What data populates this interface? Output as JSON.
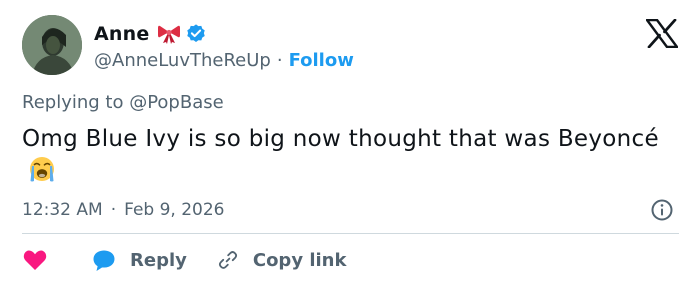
{
  "author": {
    "display_name": "Anne",
    "handle": "@AnneLuvTheReUp",
    "follow_label": "Follow",
    "separator": "·"
  },
  "reply_context": {
    "text": "Replying to @PopBase"
  },
  "tweet": {
    "text": "Omg Blue Ivy is so big now thought that was Beyoncé",
    "emoji": "loudly-crying-face"
  },
  "meta": {
    "time": "12:32 AM",
    "separator": "·",
    "date": "Feb 9, 2026"
  },
  "actions": {
    "reply_label": "Reply",
    "copy_link_label": "Copy link"
  },
  "icons": {
    "brand": "x-logo-icon",
    "verified": "verified-badge-icon",
    "bow": "ribbon-bow-icon",
    "info": "info-icon",
    "like": "heart-icon",
    "reply": "speech-bubble-icon",
    "copy": "link-icon"
  },
  "colors": {
    "accent": "#1d9bf0",
    "heart": "#f91880",
    "text_primary": "#0f1419",
    "text_secondary": "#536471",
    "divider": "#cfd9de"
  }
}
